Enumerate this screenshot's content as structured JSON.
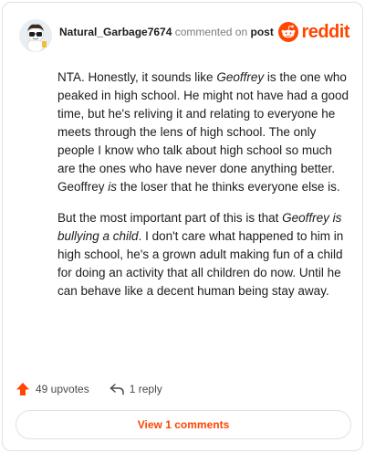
{
  "header": {
    "username": "Natural_Garbage7674",
    "action_text": "commented on",
    "post_link": "post",
    "brand": "reddit"
  },
  "comment": {
    "paragraph1": {
      "t1": "NTA. Honestly, it sounds like ",
      "em1": "Geoffrey",
      "t2": " is the one who peaked in high school. He might not have had a good time, but he's reliving it and relating to everyone he meets through the lens of high school. The only people I know who talk about high school so much are the ones who have never done anything better. Geoffrey ",
      "em2": "is",
      "t3": " the loser that he thinks everyone else is."
    },
    "paragraph2": {
      "t1": "But the most important part of this is that ",
      "em1": "Geoffrey is bullying a child",
      "t2": ". I don't care what happened to him in high school, he's a grown adult making fun of a child for doing an activity that all children do now. Until he can behave like a decent human being stay away."
    }
  },
  "actions": {
    "upvotes": "49 upvotes",
    "replies": "1 reply",
    "view_comments": "View 1 comments"
  },
  "colors": {
    "accent": "#ff4500",
    "text": "#1c1c1c",
    "muted": "#787c7e",
    "border": "#dfe1e5"
  },
  "icons": [
    "avatar",
    "reddit-logo-icon",
    "upvote-arrow-icon",
    "reply-arrow-icon"
  ]
}
